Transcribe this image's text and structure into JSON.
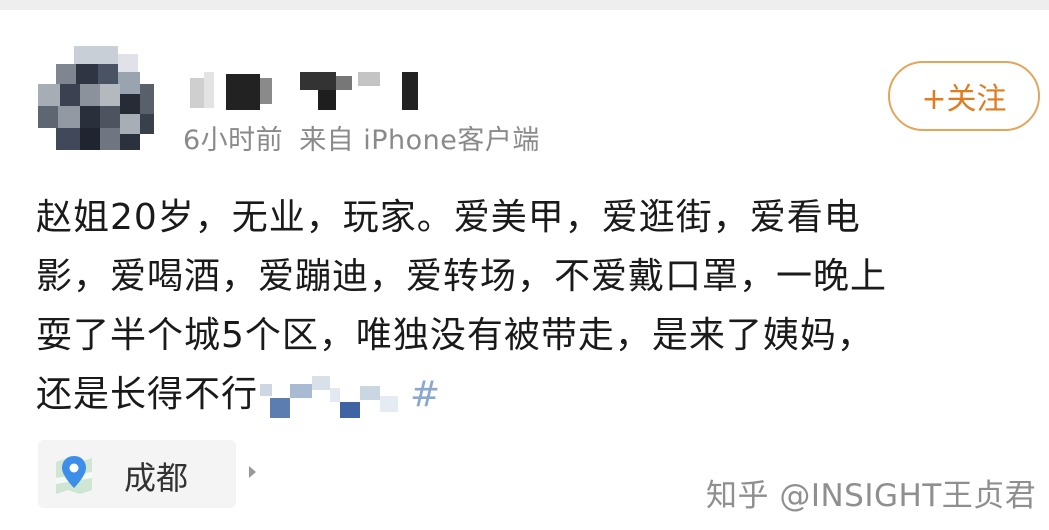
{
  "post": {
    "timestamp": "6小时前",
    "source": "来自 iPhone客户端",
    "follow_label": "+关注",
    "content_lines": [
      "赵姐20岁，无业，玩家。爱美甲，爱逛街，爱看电",
      "影，爱喝酒，爱蹦迪，爱转场，不爱戴口罩，一晚上",
      "耍了半个城5个区，唯独没有被带走，是来了姨妈，",
      "还是长得不行"
    ],
    "content_hash_tail": "#",
    "location": "成都"
  },
  "watermark": "知乎 @INSIGHT王贞君",
  "icons": {
    "location": "location-pin-icon",
    "arrow": "chevron-right-icon"
  },
  "colors": {
    "follow": "#e07c1f",
    "meta": "#8a8a8a",
    "pin": "#3d8ee8"
  }
}
